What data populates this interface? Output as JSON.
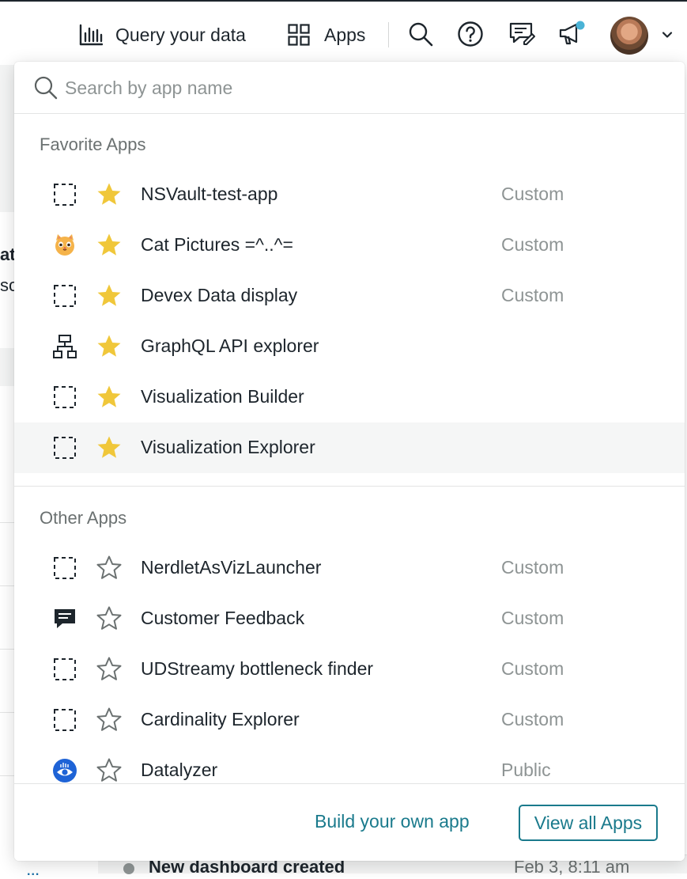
{
  "topnav": {
    "query_label": "Query your data",
    "apps_label": "Apps",
    "notification_color": "#4ab3d6"
  },
  "dropdown": {
    "search": {
      "placeholder": "Search by app name",
      "value": ""
    },
    "favorites": {
      "title": "Favorite Apps",
      "items": [
        {
          "name": "NSVault-test-app",
          "icon": "placeholder-icon",
          "starred": true,
          "type": "Custom"
        },
        {
          "name": "Cat Pictures =^..^=",
          "icon": "cat-icon",
          "starred": true,
          "type": "Custom"
        },
        {
          "name": "Devex Data display",
          "icon": "placeholder-icon",
          "starred": true,
          "type": "Custom"
        },
        {
          "name": "GraphQL API explorer",
          "icon": "hierarchy-icon",
          "starred": true,
          "type": ""
        },
        {
          "name": "Visualization Builder",
          "icon": "placeholder-icon",
          "starred": true,
          "type": ""
        },
        {
          "name": "Visualization Explorer",
          "icon": "placeholder-icon",
          "starred": true,
          "type": ""
        }
      ]
    },
    "other": {
      "title": "Other Apps",
      "items": [
        {
          "name": "NerdletAsVizLauncher",
          "icon": "placeholder-icon",
          "starred": false,
          "type": "Custom"
        },
        {
          "name": "Customer Feedback",
          "icon": "chat-icon",
          "starred": false,
          "type": "Custom"
        },
        {
          "name": "UDStreamy bottleneck finder",
          "icon": "placeholder-icon",
          "starred": false,
          "type": "Custom"
        },
        {
          "name": "Cardinality Explorer",
          "icon": "placeholder-icon",
          "starred": false,
          "type": "Custom"
        },
        {
          "name": "Datalyzer",
          "icon": "eye-chart-icon",
          "starred": false,
          "type": "Public"
        }
      ]
    },
    "footer": {
      "build_label": "Build your own app",
      "view_all_label": "View all Apps"
    }
  },
  "background": {
    "frag_1": "at",
    "frag_2": "so",
    "activity_text": "New dashboard created",
    "activity_time": "Feb 3, 8:11 am",
    "more_label": "..."
  },
  "colors": {
    "accent": "#1a7a8c",
    "star": "#f0c73a",
    "star_outline": "#6b7171"
  }
}
